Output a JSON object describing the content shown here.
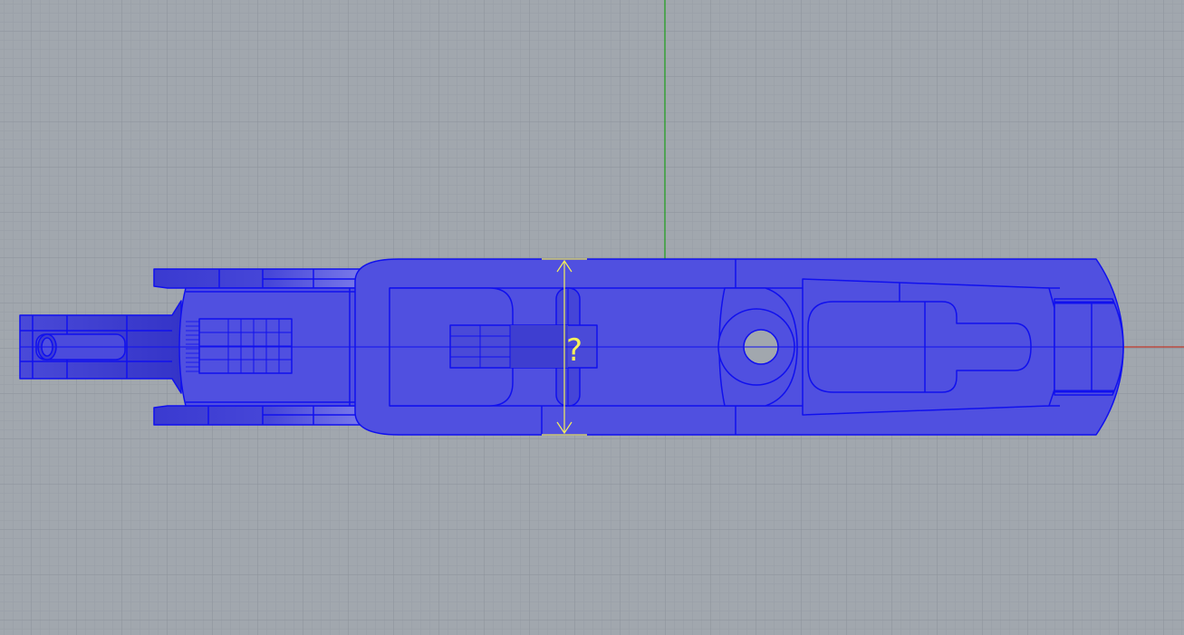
{
  "viewport": {
    "name": "Top",
    "background": "#a1a7ae",
    "grid_minor_color": "#989ea6",
    "grid_major_color": "#8c9299",
    "x_axis_color": "#c0392b",
    "y_axis_color": "#1a9e1a"
  },
  "model": {
    "fill_color": "#5050e0",
    "edge_color": "#1010ee",
    "hole_color": "#a1a7ae"
  },
  "dimension": {
    "label": "?",
    "color": "#f5f05a"
  }
}
